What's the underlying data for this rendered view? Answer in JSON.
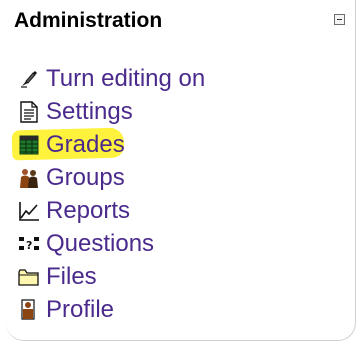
{
  "block": {
    "title": "Administration",
    "collapse_icon": "minus-box-icon"
  },
  "menu": {
    "items": [
      {
        "label": "Turn editing on",
        "icon": "edit-pen-icon"
      },
      {
        "label": "Settings",
        "icon": "settings-document-icon"
      },
      {
        "label": "Grades",
        "icon": "grades-table-icon",
        "highlighted": true
      },
      {
        "label": "Groups",
        "icon": "groups-people-icon"
      },
      {
        "label": "Reports",
        "icon": "reports-chart-icon"
      },
      {
        "label": "Questions",
        "icon": "questions-icon"
      },
      {
        "label": "Files",
        "icon": "folder-icon"
      },
      {
        "label": "Profile",
        "icon": "profile-icon"
      }
    ]
  },
  "colors": {
    "link": "#4a2a8c",
    "highlight": "#fff23c",
    "title": "#000000"
  }
}
